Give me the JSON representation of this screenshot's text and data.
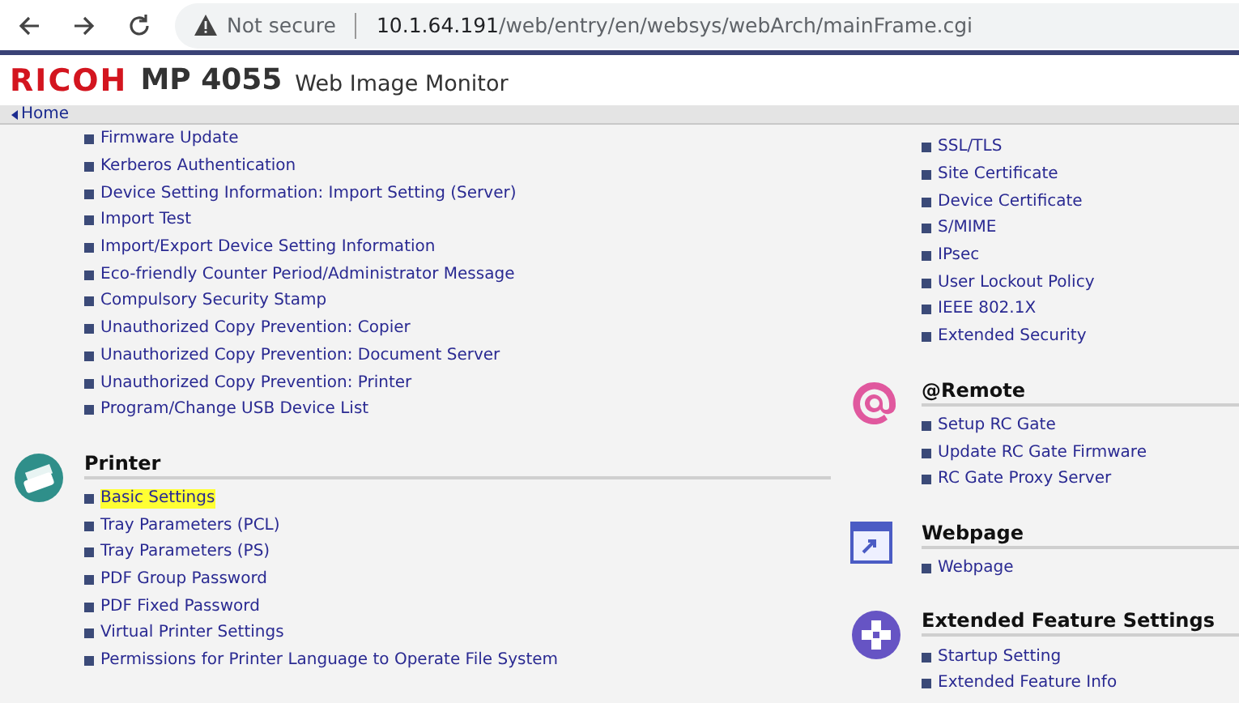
{
  "browser": {
    "security": "Not secure",
    "url_host": "10.1.64.191",
    "url_path": "/web/entry/en/websys/webArch/mainFrame.cgi"
  },
  "header": {
    "brand": "RICOH",
    "model": "MP 4055",
    "product": "Web Image Monitor"
  },
  "nav": {
    "home": "Home"
  },
  "left_column": [
    {
      "kind": "plain",
      "items": [
        {
          "label": "Firmware Update",
          "highlighted": false
        },
        {
          "label": "Kerberos Authentication",
          "highlighted": false
        },
        {
          "label": "Device Setting Information: Import Setting (Server)",
          "highlighted": false
        },
        {
          "label": "Import Test",
          "highlighted": false
        },
        {
          "label": "Import/Export Device Setting Information",
          "highlighted": false
        },
        {
          "label": "Eco-friendly Counter Period/Administrator Message",
          "highlighted": false
        },
        {
          "label": "Compulsory Security Stamp",
          "highlighted": false
        },
        {
          "label": "Unauthorized Copy Prevention: Copier",
          "highlighted": false
        },
        {
          "label": "Unauthorized Copy Prevention: Document Server",
          "highlighted": false
        },
        {
          "label": "Unauthorized Copy Prevention: Printer",
          "highlighted": false
        },
        {
          "label": "Program/Change USB Device List",
          "highlighted": false
        }
      ]
    },
    {
      "title": "Printer",
      "kind": "printer",
      "items": [
        {
          "label": "Basic Settings",
          "highlighted": true
        },
        {
          "label": "Tray Parameters (PCL)",
          "highlighted": false
        },
        {
          "label": "Tray Parameters (PS)",
          "highlighted": false
        },
        {
          "label": "PDF Group Password",
          "highlighted": false
        },
        {
          "label": "PDF Fixed Password",
          "highlighted": false
        },
        {
          "label": "Virtual Printer Settings",
          "highlighted": false
        },
        {
          "label": "Permissions for Printer Language to Operate File System",
          "highlighted": false
        }
      ]
    }
  ],
  "right_column": [
    {
      "kind": "plain",
      "items": [
        {
          "label": "SSL/TLS",
          "highlighted": false
        },
        {
          "label": "Site Certificate",
          "highlighted": false
        },
        {
          "label": "Device Certificate",
          "highlighted": false
        },
        {
          "label": "S/MIME",
          "highlighted": false
        },
        {
          "label": "IPsec",
          "highlighted": false
        },
        {
          "label": "User Lockout Policy",
          "highlighted": false
        },
        {
          "label": "IEEE 802.1X",
          "highlighted": false
        },
        {
          "label": "Extended Security",
          "highlighted": false
        }
      ]
    },
    {
      "title": "@Remote",
      "kind": "remote",
      "items": [
        {
          "label": "Setup RC Gate",
          "highlighted": false
        },
        {
          "label": "Update RC Gate Firmware",
          "highlighted": false
        },
        {
          "label": "RC Gate Proxy Server",
          "highlighted": false
        }
      ]
    },
    {
      "title": "Webpage",
      "kind": "webpage",
      "items": [
        {
          "label": "Webpage",
          "highlighted": false
        }
      ]
    },
    {
      "title": "Extended Feature Settings",
      "kind": "extended",
      "items": [
        {
          "label": "Startup Setting",
          "highlighted": false
        },
        {
          "label": "Extended Feature Info",
          "highlighted": false
        }
      ]
    }
  ]
}
